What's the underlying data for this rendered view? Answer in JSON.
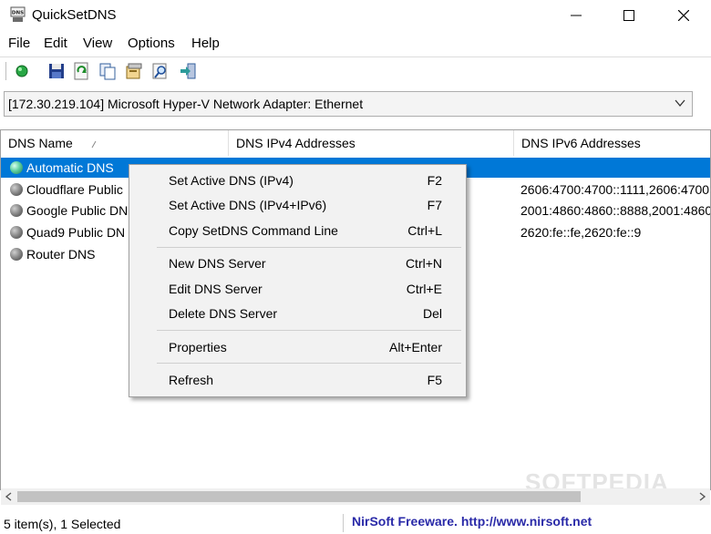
{
  "window": {
    "title": "QuickSetDNS"
  },
  "menu": [
    "File",
    "Edit",
    "View",
    "Options",
    "Help"
  ],
  "adapter": {
    "selected": "[172.30.219.104]  Microsoft Hyper-V Network Adapter: Ethernet"
  },
  "columns": [
    "DNS Name",
    "DNS IPv4 Addresses",
    "DNS IPv6 Addresses"
  ],
  "rows": [
    {
      "name": "Automatic DNS",
      "ipv4": "",
      "ipv6": ""
    },
    {
      "name": "Cloudflare Public",
      "ipv4": "",
      "ipv6": "2606:4700:4700::1111,2606:4700:"
    },
    {
      "name": "Google Public DN",
      "ipv4": "",
      "ipv6": "2001:4860:4860::8888,2001:4860:"
    },
    {
      "name": "Quad9 Public DN",
      "ipv4": "",
      "ipv6": "2620:fe::fe,2620:fe::9"
    },
    {
      "name": "Router DNS",
      "ipv4": "",
      "ipv6": ""
    }
  ],
  "context_menu": [
    {
      "label": "Set Active DNS (IPv4)",
      "key": "F2"
    },
    {
      "label": "Set Active DNS (IPv4+IPv6)",
      "key": "F7"
    },
    {
      "label": "Copy SetDNS Command Line",
      "key": "Ctrl+L"
    },
    {
      "label": "New DNS Server",
      "key": "Ctrl+N"
    },
    {
      "label": "Edit DNS Server",
      "key": "Ctrl+E"
    },
    {
      "label": "Delete DNS Server",
      "key": "Del"
    },
    {
      "label": "Properties",
      "key": "Alt+Enter"
    },
    {
      "label": "Refresh",
      "key": "F5"
    }
  ],
  "status": {
    "left": "5 item(s), 1 Selected",
    "right": "NirSoft Freeware.  http://www.nirsoft.net"
  },
  "watermark": "SOFTPEDIA",
  "colors": {
    "selection": "#0078d7",
    "link": "#2a2aa8"
  }
}
